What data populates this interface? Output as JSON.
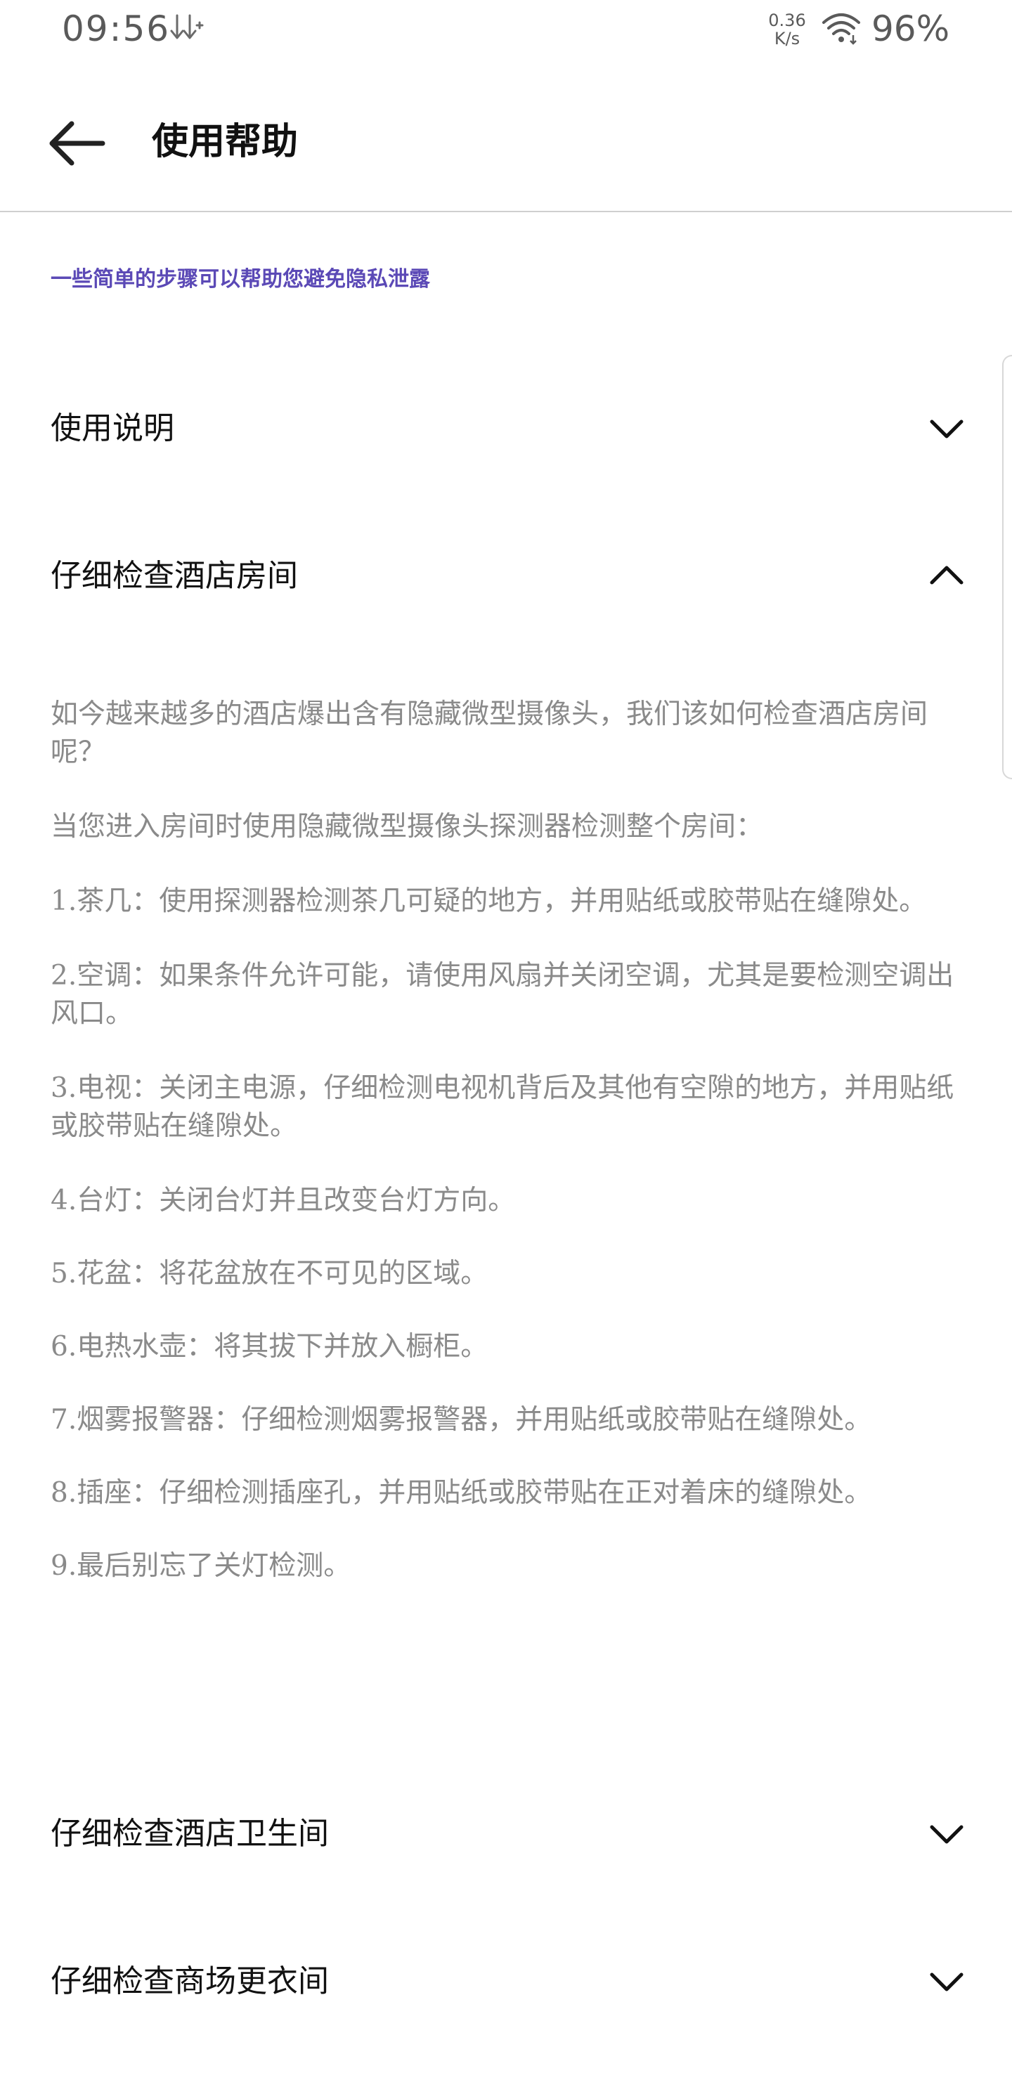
{
  "status_bar": {
    "time": "09:56",
    "net_speed_value": "0.36",
    "net_speed_unit": "K/s",
    "battery": "96%"
  },
  "header": {
    "title": "使用帮助"
  },
  "hint": "一些简单的步骤可以帮助您避免隐私泄露",
  "sections": [
    {
      "title": "使用说明",
      "expanded": false
    },
    {
      "title": "仔细检查酒店房间",
      "expanded": true
    },
    {
      "title": "仔细检查酒店卫生间",
      "expanded": false
    },
    {
      "title": "仔细检查商场更衣间",
      "expanded": false
    }
  ],
  "hotel_room_content": {
    "intro": "如今越来越多的酒店爆出含有隐藏微型摄像头，我们该如何检查酒店房间呢？",
    "instruction": "当您进入房间时使用隐藏微型摄像头探测器检测整个房间：",
    "steps": [
      "1.茶几：使用探测器检测茶几可疑的地方，并用贴纸或胶带贴在缝隙处。",
      "2.空调：如果条件允许可能，请使用风扇并关闭空调，尤其是要检测空调出风口。",
      "3.电视：关闭主电源，仔细检测电视机背后及其他有空隙的地方，并用贴纸或胶带贴在缝隙处。",
      "4.台灯：关闭台灯并且改变台灯方向。",
      "5.花盆：将花盆放在不可见的区域。",
      "6.电热水壶：将其拔下并放入橱柜。",
      "7.烟雾报警器：仔细检测烟雾报警器，并用贴纸或胶带贴在缝隙处。",
      "8.插座：仔细检测插座孔，并用贴纸或胶带贴在正对着床的缝隙处。",
      "9.最后别忘了关灯检测。"
    ]
  },
  "icons": {
    "back": "arrow-left-icon",
    "collapsed": "chevron-down-icon",
    "expanded": "chevron-up-icon",
    "wifi": "wifi-icon",
    "download": "download-arrows-icon"
  },
  "colors": {
    "hint": "#5b49b6",
    "body_text": "#8a8a8a",
    "title_text": "#111111",
    "divider": "#cfcfcf"
  }
}
